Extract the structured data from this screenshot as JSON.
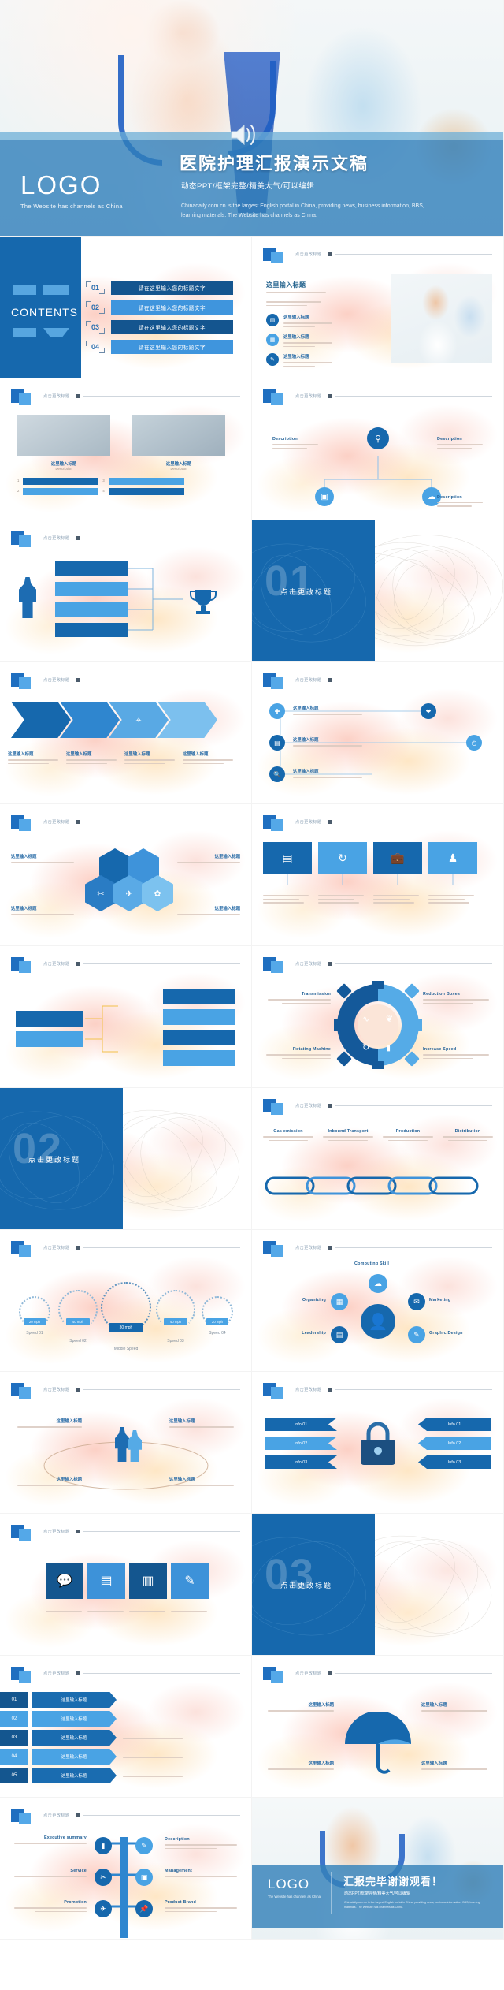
{
  "brand": {
    "primary": "#1668ad",
    "light": "#49a3e4",
    "accent_bar": "#2f7eba",
    "wash_warm": "#f6c9a8"
  },
  "cover": {
    "logo": "LOGO",
    "logo_sub": "The Website has channels as China",
    "title": "医院护理汇报演示文稿",
    "subtitle_cn": "动态PPT/框架完整/精美大气/可以编辑",
    "subtitle_en": "Chinadaily.com.cn is the largest English portal in China, providing news, business information, BBS, learning materials. The Website has channels as China.",
    "speaker_icon": "speaker-icon"
  },
  "slide_header": {
    "label": "点击更改标题",
    "square_icon": "stacked-squares-icon"
  },
  "contents": {
    "heading": "CONTENTS",
    "items": [
      {
        "num": "01",
        "label": "请在这里输入您的标题文字"
      },
      {
        "num": "02",
        "label": "请在这里输入您的标题文字"
      },
      {
        "num": "03",
        "label": "请在这里输入您的标题文字"
      },
      {
        "num": "04",
        "label": "请在这里输入您的标题文字"
      }
    ]
  },
  "common": {
    "title_cn": "这里输入标题",
    "sub_title_cn": "这里输入标题",
    "body_cn": "点击更改文字内容点击更改文字内容点击更改文字内容",
    "body_cn_short": "点击更改文字内容点击更改文字内容",
    "click_edit": "点击更改标题"
  },
  "dividers": [
    {
      "num": "01",
      "label": "点击更改标题"
    },
    {
      "num": "02",
      "label": "点击更改标题"
    },
    {
      "num": "03",
      "label": "点击更改标题"
    }
  ],
  "gear_slide": {
    "labels": [
      {
        "title": "Transmission",
        "icon": "chart-line-icon"
      },
      {
        "title": "Reduction Boxes",
        "icon": "group-icon"
      },
      {
        "title": "Rotating Machine",
        "icon": "refresh-icon"
      },
      {
        "title": "Increase Speed",
        "icon": "bar-chart-icon"
      }
    ],
    "body": "点击更改文字内容点击更改文字内容"
  },
  "chain_slide": {
    "labels": [
      "Gas emission",
      "Inbound Transport",
      "Production",
      "Distribution"
    ]
  },
  "speed_slide": {
    "gauges": [
      {
        "label": "Speed 01",
        "value": "20 mph"
      },
      {
        "label": "Speed 02",
        "value": "40 mph"
      },
      {
        "label": "Middle Speed",
        "value": "30 mph"
      },
      {
        "label": "Speed 03",
        "value": "40 mph"
      },
      {
        "label": "Speed 04",
        "value": "20 mph"
      }
    ],
    "body": "点击更改文字内容点击更改文字内容"
  },
  "skills_slide": {
    "top": "Computing Skill",
    "left": [
      "Organizing",
      "Leadership"
    ],
    "right": [
      "Marketing",
      "Graphic Design"
    ],
    "center_icon": "person-icon"
  },
  "lock_slide": {
    "ribbons_left": [
      "Info 01",
      "Info 02",
      "Info 03"
    ],
    "ribbons_right": [
      "Info 01",
      "Info 02",
      "Info 03"
    ],
    "icon": "padlock-icon"
  },
  "numbered_list": {
    "rows": [
      {
        "num": "01",
        "label": "这里输入标题",
        "body": "点击更改文字内容点击更改文字内容点击更改文字内容"
      },
      {
        "num": "02",
        "label": "这里输入标题",
        "body": "点击更改文字内容点击更改文字内容点击更改文字内容"
      },
      {
        "num": "03",
        "label": "这里输入标题",
        "body": "点击更改文字内容点击更改文字内容点击更改文字内容"
      },
      {
        "num": "04",
        "label": "这里输入标题",
        "body": "点击更改文字内容点击更改文字内容点击更改文字内容"
      },
      {
        "num": "05",
        "label": "这里输入标题",
        "body": "点击更改文字内容点击更改文字内容点击更改文字内容"
      }
    ]
  },
  "tree_slide": {
    "nodes": [
      {
        "title": "Executive summary",
        "icon": "bar-chart-icon",
        "side": "left"
      },
      {
        "title": "Description",
        "icon": "leaf-icon",
        "side": "right"
      },
      {
        "title": "Service",
        "icon": "tools-icon",
        "side": "left"
      },
      {
        "title": "Management",
        "icon": "frame-icon",
        "side": "right"
      },
      {
        "title": "Promotion",
        "icon": "plane-icon",
        "side": "left"
      },
      {
        "title": "Product Brand",
        "icon": "pin-icon",
        "side": "right"
      }
    ],
    "body": "点击更改文字内容点击更改文字内容点击更改文字内容"
  },
  "umbrella_slide": {
    "icon": "umbrella-icon"
  },
  "trophy_slide": {
    "icon": "trophy-icon",
    "person_icon": "person-silhouette-icon"
  },
  "hex_slide": {
    "icons": [
      "tools-icon",
      "plane-icon",
      "leaf-icon"
    ]
  },
  "end": {
    "logo": "LOGO",
    "logo_sub": "The Website has channels as China",
    "title": "汇报完毕谢谢观看！",
    "subtitle_cn": "动态PPT/框架完整/精美大气/可以编辑",
    "subtitle_en": "Chinadaily.com.cn is the largest English portal in China, providing news, business information, BBS, learning materials. The Website has channels as China."
  }
}
